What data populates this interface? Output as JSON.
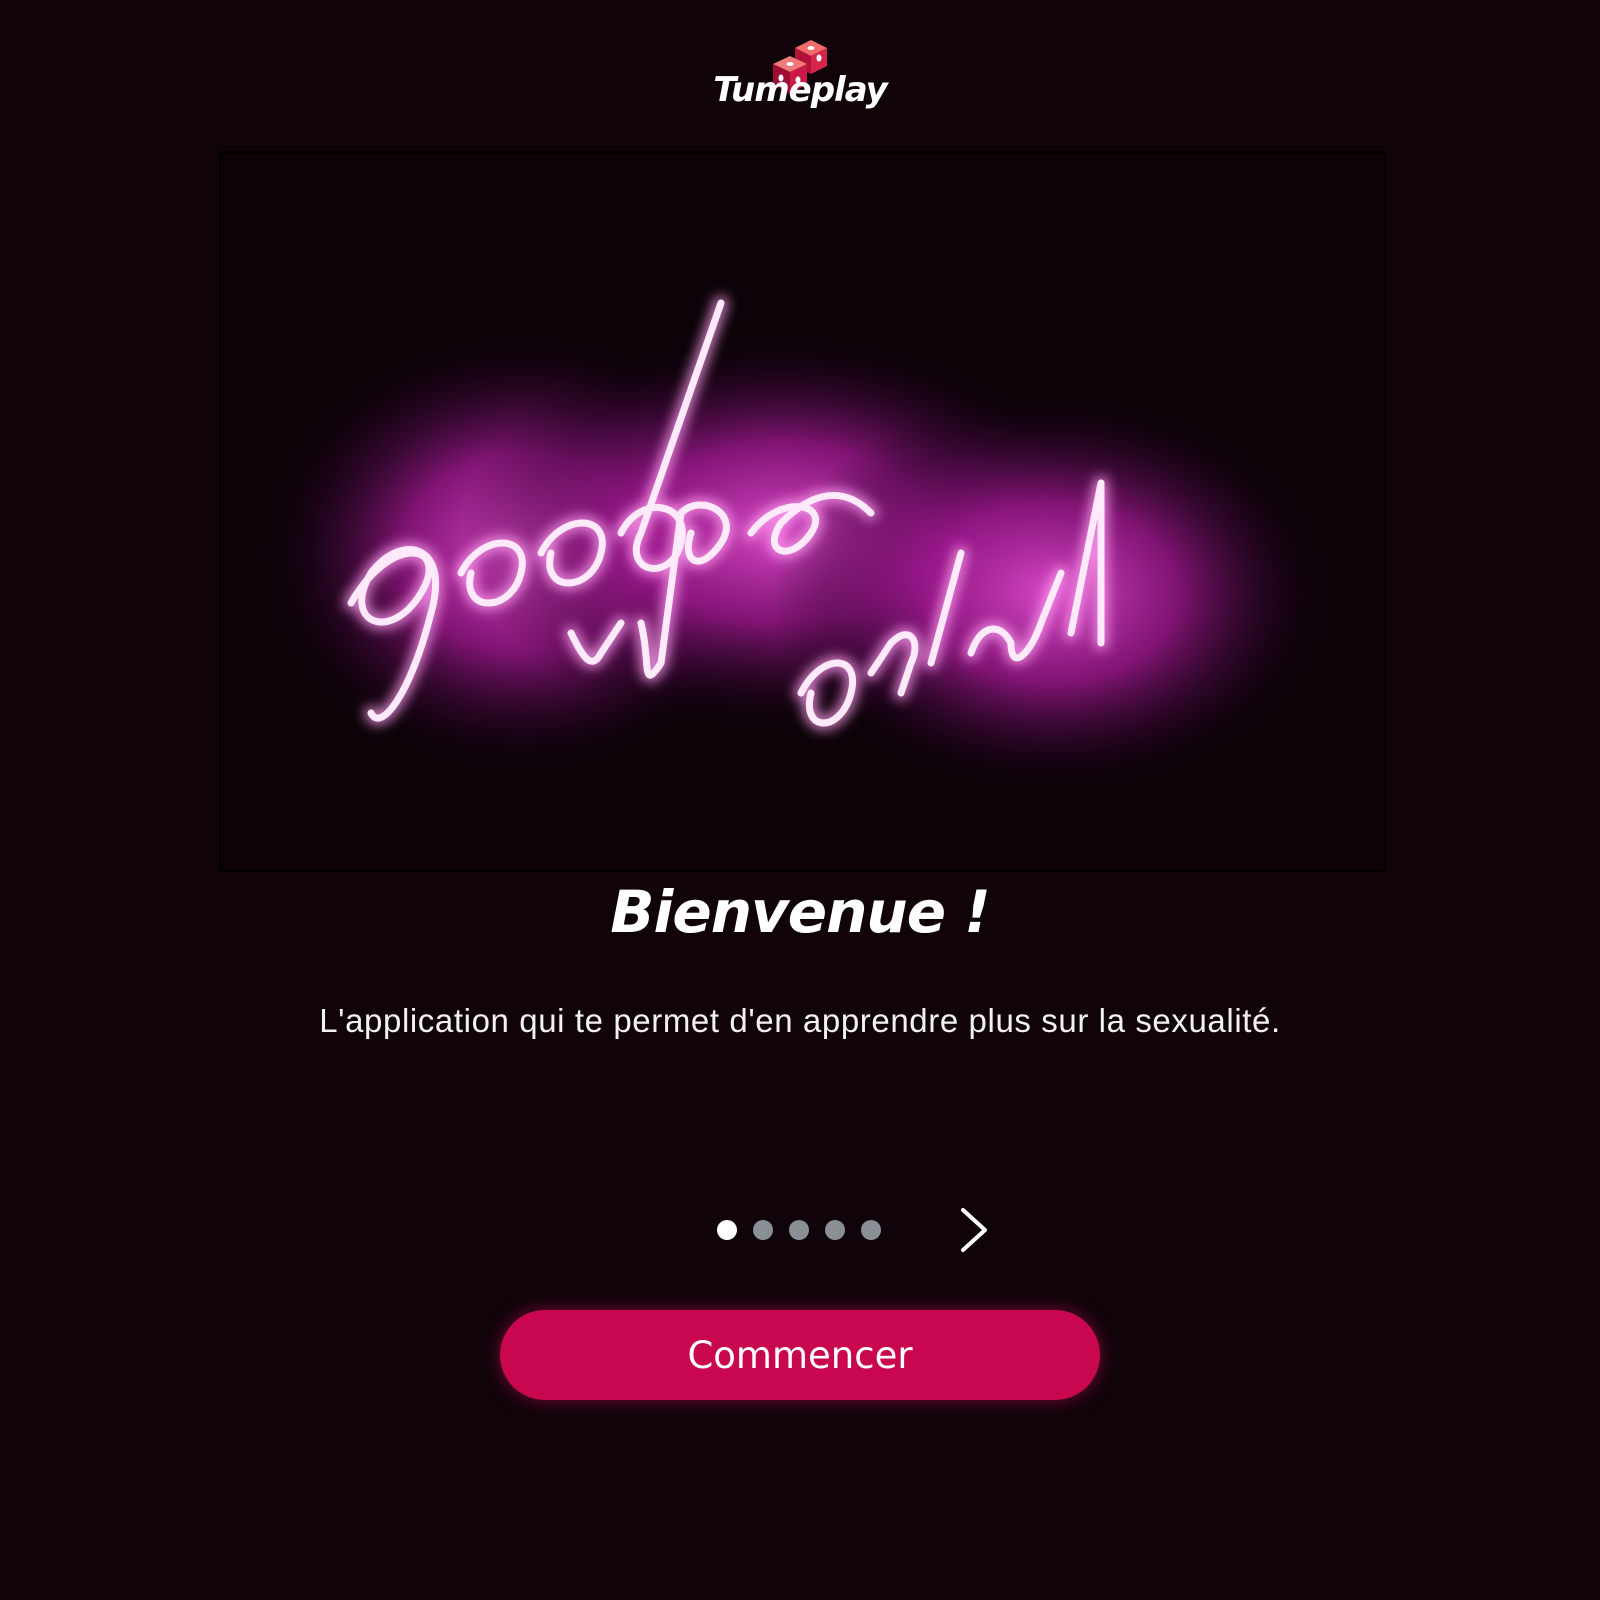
{
  "app": {
    "logo_text": "Tumeplay",
    "logo_icon": "dice-icon"
  },
  "hero": {
    "image_icon": "neon-sign-image",
    "neon_text": "good vibes only"
  },
  "welcome": {
    "title": "Bienvenue !",
    "subtitle": "L'application qui te permet d'en apprendre plus sur la sexualité."
  },
  "pagination": {
    "total": 5,
    "current": 1,
    "next_icon": "chevron-right-icon"
  },
  "cta": {
    "label": "Commencer"
  },
  "colors": {
    "background": "#10040a",
    "accent": "#c90750",
    "dot_active": "#ffffff",
    "dot_inactive": "#8a8f96",
    "neon": "#e040c8"
  }
}
